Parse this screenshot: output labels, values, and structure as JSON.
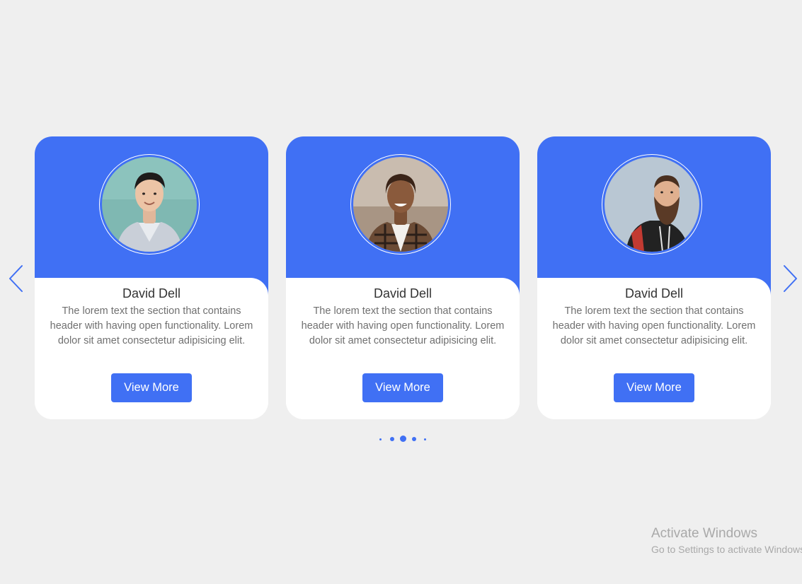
{
  "carousel": {
    "cards": [
      {
        "name": "David Dell",
        "description": "The lorem text the section that contains header with having open functionality. Lorem dolor sit amet consectetur adipisicing elit.",
        "button_label": "View More"
      },
      {
        "name": "David Dell",
        "description": "The lorem text the section that contains header with having open functionality. Lorem dolor sit amet consectetur adipisicing elit.",
        "button_label": "View More"
      },
      {
        "name": "David Dell",
        "description": "The lorem text the section that contains header with having open functionality. Lorem dolor sit amet consectetur adipisicing elit.",
        "button_label": "View More"
      }
    ],
    "prev_icon": "chevron-left-icon",
    "next_icon": "chevron-right-icon",
    "pagination": {
      "dot_count": 5,
      "active_index": 2
    }
  },
  "colors": {
    "accent": "#4070f4",
    "background": "#efefef",
    "card": "#ffffff",
    "heading": "#333333",
    "body_text": "#707070"
  },
  "watermark": {
    "title": "Activate Windows",
    "subtitle": "Go to Settings to activate Windows."
  }
}
